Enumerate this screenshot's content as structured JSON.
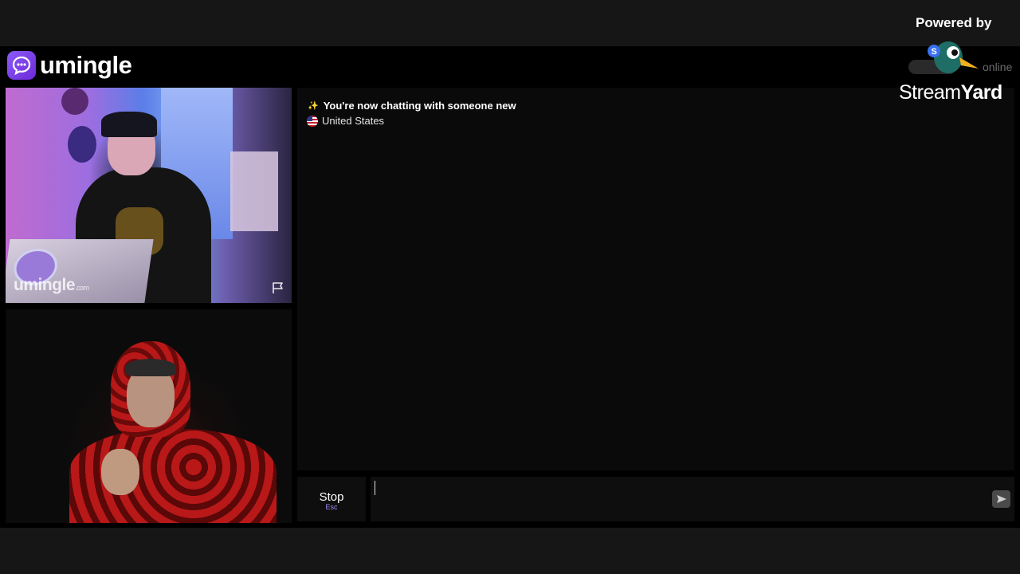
{
  "app": {
    "brand": "umingle",
    "online_label": "online"
  },
  "videos": {
    "remote_watermark": "umingle",
    "remote_watermark_suffix": ".com"
  },
  "chat": {
    "messages": [
      {
        "icon": "sparkles-icon",
        "text": "You're now chatting with someone new"
      },
      {
        "icon": "us-flag-icon",
        "text": "United States"
      }
    ]
  },
  "controls": {
    "stop_label": "Stop",
    "stop_shortcut": "Esc",
    "input_value": "",
    "send_icon": "send-icon"
  },
  "overlay": {
    "powered_by": "Powered by",
    "streamyard_thin": "Stream",
    "streamyard_bold": "Yard"
  },
  "colors": {
    "accent": "#8b5cf6",
    "background": "#000000",
    "chat_bg": "#0a0a0a"
  }
}
